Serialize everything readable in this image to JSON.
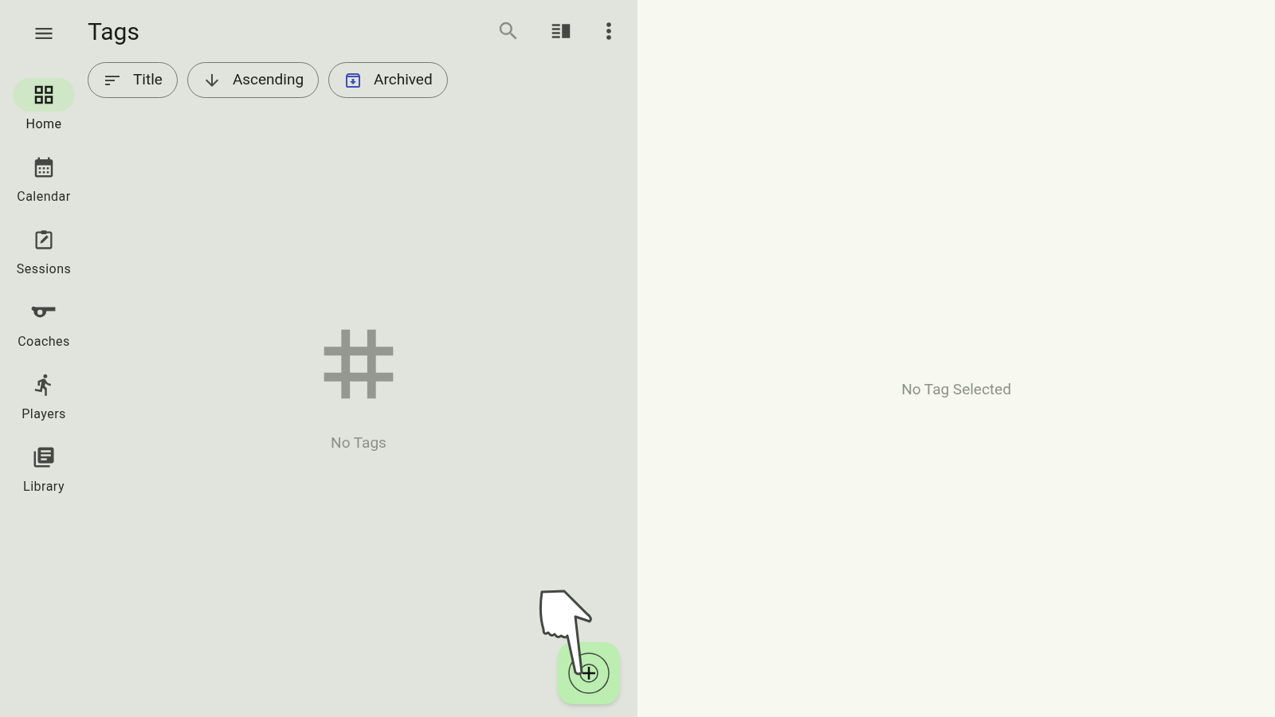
{
  "app_bar": {
    "title": "Tags"
  },
  "nav_items": [
    {
      "label": "Home",
      "selected": true
    },
    {
      "label": "Calendar",
      "selected": false
    },
    {
      "label": "Sessions",
      "selected": false
    },
    {
      "label": "Coaches",
      "selected": false
    },
    {
      "label": "Players",
      "selected": false
    },
    {
      "label": "Library",
      "selected": false
    }
  ],
  "filter_chips": [
    {
      "label": "Title",
      "active": false
    },
    {
      "label": "Ascending",
      "active": false
    },
    {
      "label": "Archived",
      "active": true
    }
  ],
  "empty_state": {
    "message": "No Tags"
  },
  "detail_pane": {
    "message": "No Tag Selected"
  }
}
